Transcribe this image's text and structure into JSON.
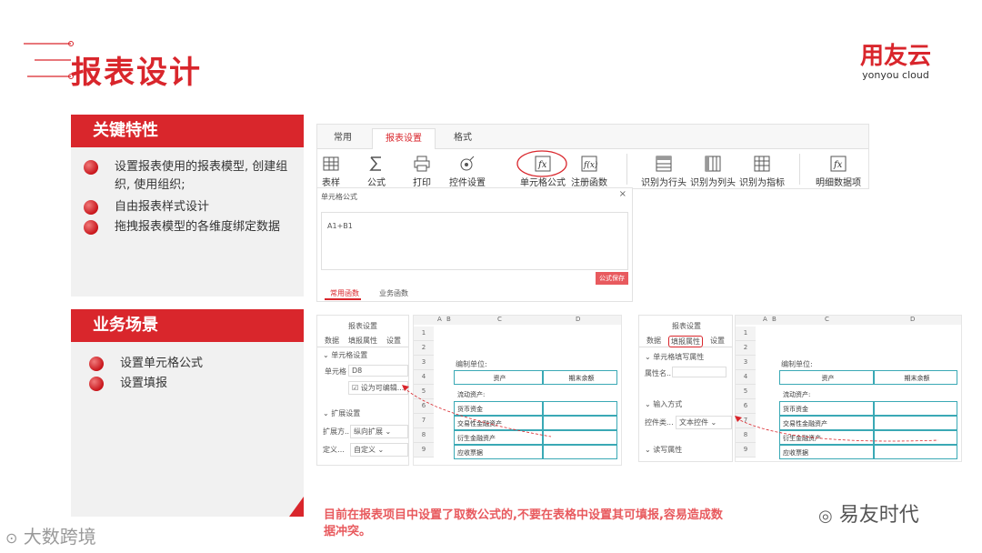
{
  "header": {
    "title": "报表设计",
    "logo_cn": "用友云",
    "logo_en": "yonyou cloud"
  },
  "features": {
    "heading": "关键特性",
    "items": [
      "设置报表使用的报表模型, 创建组织, 使用组织;",
      "自由报表样式设计",
      "拖拽报表模型的各维度绑定数据"
    ]
  },
  "scenario": {
    "heading": "业务场景",
    "items": [
      "设置单元格公式",
      "设置填报"
    ]
  },
  "ribbon": {
    "tabs": [
      "常用",
      "报表设置",
      "格式"
    ],
    "tools": [
      {
        "label": "表样",
        "icon": "table-icon"
      },
      {
        "label": "公式",
        "icon": "sigma-icon"
      },
      {
        "label": "打印",
        "icon": "print-icon"
      },
      {
        "label": "控件设置",
        "icon": "control-icon"
      },
      {
        "label": "单元格公式",
        "icon": "fx-icon"
      },
      {
        "label": "注册函数",
        "icon": "fx-register-icon"
      },
      {
        "label": "识别为行头",
        "icon": "row-head-icon"
      },
      {
        "label": "识别为列头",
        "icon": "col-head-icon"
      },
      {
        "label": "识别为指标",
        "icon": "indicator-icon"
      },
      {
        "label": "明细数据项",
        "icon": "detail-icon"
      }
    ]
  },
  "formula_dialog": {
    "title": "单元格公式",
    "content": "A1+B1",
    "save_button": "公式保存",
    "tabs": [
      "常用函数",
      "业务函数"
    ]
  },
  "left_screen": {
    "panel_title": "报表设置",
    "panel_tabs": [
      "数据",
      "填报属性",
      "设置"
    ],
    "section1": "单元格设置",
    "cell_label": "单元格",
    "cell_value": "D8",
    "checkbox_label": "设为可编辑...",
    "section2": "扩展设置",
    "expand_dir_label": "扩展方...",
    "expand_dir_value": "纵向扩展",
    "define_label": "定义…",
    "define_value": "自定义",
    "col_letters": [
      "A",
      "B",
      "C",
      "D"
    ],
    "rows": [
      "1",
      "2",
      "3",
      "4",
      "5",
      "6",
      "7",
      "8",
      "9"
    ],
    "unit_label": "编制单位:",
    "col_header_asset": "资产",
    "col_header_amount": "期末余额",
    "row_items": [
      "流动资产:",
      "货币资金",
      "交易性金融资产",
      "衍生金融资产",
      "应收票据"
    ]
  },
  "right_screen": {
    "panel_title": "报表设置",
    "panel_tabs": [
      "数据",
      "填报属性",
      "设置"
    ],
    "section1": "单元格填写属性",
    "attr_label": "属性名...",
    "section2": "输入方式",
    "control_label": "控件类...",
    "control_value": "文本控件",
    "section3": "读写属性",
    "col_letters": [
      "A",
      "B",
      "C",
      "D"
    ],
    "rows": [
      "1",
      "2",
      "3",
      "4",
      "5",
      "6",
      "7",
      "8",
      "9"
    ],
    "unit_label": "编制单位:",
    "col_header_asset": "资产",
    "col_header_amount": "期末余额",
    "row_items": [
      "流动资产:",
      "货币资金",
      "交易性金融资产",
      "衍生金融资产",
      "应收票据"
    ]
  },
  "note": "目前在报表项目中设置了取数公式的,不要在表格中设置其可填报,容易造成数据冲突。",
  "watermarks": {
    "left": "大数跨境",
    "right": "易友时代"
  },
  "colors": {
    "brand_red": "#d9262c",
    "note_red": "#e85a5e",
    "teal": "#3aa9b5"
  }
}
